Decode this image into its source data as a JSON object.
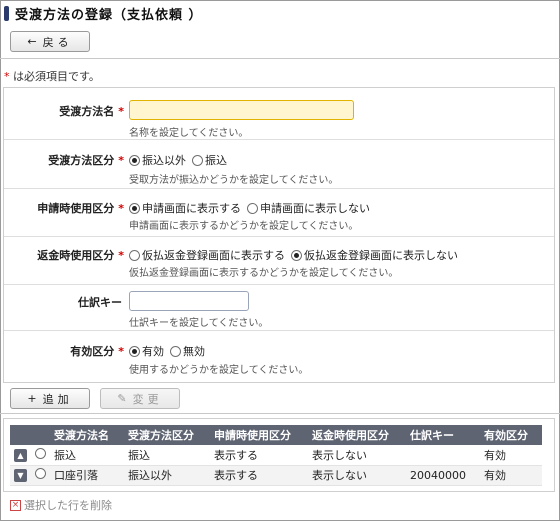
{
  "page": {
    "title": "受渡方法の登録（支払依頼 ）"
  },
  "toolbar": {
    "back_icon": "←",
    "back_label": "戻る"
  },
  "required_note": {
    "mark": "*",
    "text": " は必須項目です。"
  },
  "form": {
    "required_mark": "*",
    "name": {
      "label": "受渡方法名",
      "value": "",
      "help": "名称を設定してください。"
    },
    "category": {
      "label": "受渡方法区分",
      "options": [
        "振込以外",
        "振込"
      ],
      "selected": "振込以外",
      "help": "受取方法が振込かどうかを設定してください。"
    },
    "apply_use": {
      "label": "申請時使用区分",
      "options": [
        "申請画面に表示する",
        "申請画面に表示しない"
      ],
      "selected": "申請画面に表示する",
      "help": "申請画面に表示するかどうかを設定してください。"
    },
    "return_use": {
      "label": "返金時使用区分",
      "options": [
        "仮払返金登録画面に表示する",
        "仮払返金登録画面に表示しない"
      ],
      "selected": "仮払返金登録画面に表示しない",
      "help": "仮払返金登録画面に表示するかどうかを設定してください。"
    },
    "journal_key": {
      "label": "仕訳キー",
      "value": "",
      "help": "仕訳キーを設定してください。"
    },
    "valid": {
      "label": "有効区分",
      "options": [
        "有効",
        "無効"
      ],
      "selected": "有効",
      "help": "使用するかどうかを設定してください。"
    }
  },
  "actions": {
    "add_icon": "+",
    "add_label": "追加",
    "edit_icon": "✎",
    "edit_label": "変更"
  },
  "table": {
    "columns": [
      "受渡方法名",
      "受渡方法区分",
      "申請時使用区分",
      "返金時使用区分",
      "仕訳キー",
      "有効区分"
    ],
    "rows": [
      {
        "move": "up",
        "cells": [
          "振込",
          "振込",
          "表示する",
          "表示しない",
          "",
          "有効"
        ]
      },
      {
        "move": "down",
        "cells": [
          "口座引落",
          "振込以外",
          "表示する",
          "表示しない",
          "20040000",
          "有効"
        ]
      }
    ]
  },
  "delete_label": "選択した行を削除"
}
